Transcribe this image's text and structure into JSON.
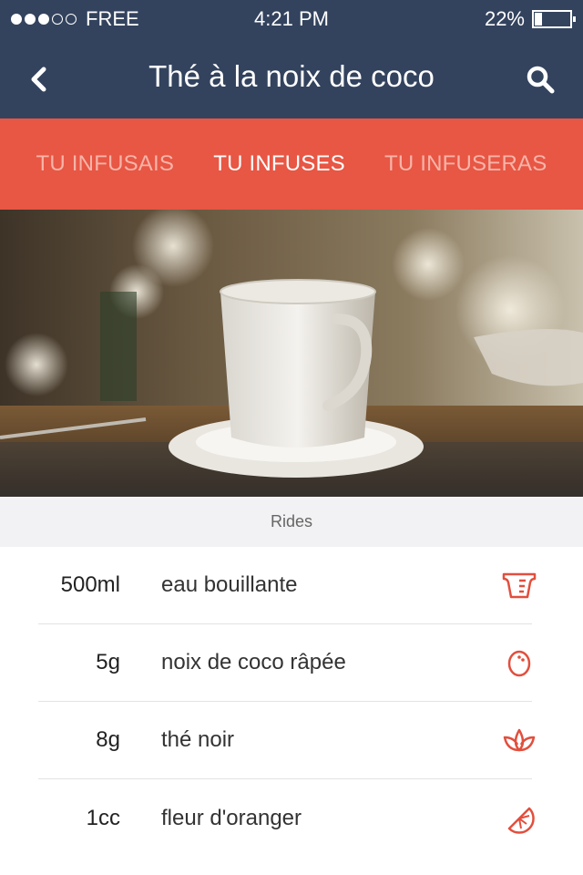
{
  "status_bar": {
    "carrier": "FREE",
    "signal_bars_filled": 3,
    "signal_bars_total": 5,
    "time": "4:21  PM",
    "battery_text": "22%",
    "battery_level": 0.22
  },
  "nav": {
    "title": "Thé à la noix de coco",
    "back_icon": "chevron-left-icon",
    "search_icon": "search-icon"
  },
  "tabs": [
    {
      "label": "TU INFUSAIS",
      "active": false
    },
    {
      "label": "TU INFUSES",
      "active": true
    },
    {
      "label": "TU INFUSERAS",
      "active": false
    }
  ],
  "hero": {
    "subject": "tea-cup-photo"
  },
  "subtitle": "Rides",
  "ingredients": [
    {
      "qty": "500ml",
      "name": "eau bouillante",
      "icon": "measuring-cup-icon"
    },
    {
      "qty": "5g",
      "name": "noix de coco râpée",
      "icon": "coconut-icon"
    },
    {
      "qty": "8g",
      "name": "thé noir",
      "icon": "tea-leaf-icon"
    },
    {
      "qty": "1cc",
      "name": "fleur d'oranger",
      "icon": "orange-slice-icon"
    }
  ],
  "colors": {
    "nav_bg": "#33435e",
    "tab_bg": "#e85644",
    "tab_inactive": "#f7b4a8",
    "icon_accent": "#e24f3d"
  }
}
